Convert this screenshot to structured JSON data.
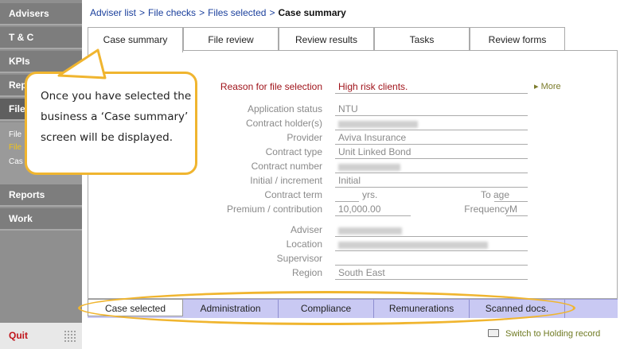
{
  "sidebar": {
    "items": [
      {
        "label": "Advisers"
      },
      {
        "label": "T & C"
      },
      {
        "label": "KPIs"
      },
      {
        "label": "Rep"
      },
      {
        "label": "File"
      },
      {
        "label": "Reports"
      },
      {
        "label": "Work"
      }
    ],
    "subitems": [
      {
        "label": "File"
      },
      {
        "label": "File"
      },
      {
        "label": "Cas"
      }
    ],
    "quit_label": "Quit"
  },
  "breadcrumb": {
    "items": [
      "Adviser list",
      "File checks",
      "Files selected"
    ],
    "separator": ">",
    "current": "Case summary"
  },
  "top_tabs": [
    "Case summary",
    "File review",
    "Review results",
    "Tasks",
    "Review forms"
  ],
  "form": {
    "reason_label": "Reason for file selection",
    "reason_value": "High risk clients.",
    "more_label": "More",
    "fields": {
      "application_status": {
        "label": "Application status",
        "value": "NTU"
      },
      "contract_holders": {
        "label": "Contract holder(s)",
        "value": ""
      },
      "provider": {
        "label": "Provider",
        "value": "Aviva Insurance"
      },
      "contract_type": {
        "label": "Contract type",
        "value": "Unit Linked Bond"
      },
      "contract_number": {
        "label": "Contract number",
        "value": ""
      },
      "initial_increment": {
        "label": "Initial / increment",
        "value": "Initial"
      },
      "contract_term": {
        "label": "Contract term",
        "value": "",
        "unit": "yrs."
      },
      "to_age": {
        "label": "To age",
        "value": ""
      },
      "premium": {
        "label": "Premium / contribution",
        "value": "10,000.00"
      },
      "frequency": {
        "label": "Frequency",
        "value": "M"
      },
      "adviser": {
        "label": "Adviser",
        "value": ""
      },
      "location": {
        "label": "Location",
        "value": ""
      },
      "supervisor": {
        "label": "Supervisor",
        "value": ""
      },
      "region": {
        "label": "Region",
        "value": "South East"
      }
    }
  },
  "bottom_tabs": [
    "Case selected",
    "Administration",
    "Compliance",
    "Remunerations",
    "Scanned docs."
  ],
  "holding_link": "Switch to Holding record",
  "callout": {
    "text": "Once you have selected the business a ‘Case summary’ screen will be displayed."
  },
  "colors": {
    "sidebar": "#7d7d7d",
    "highlight": "#f0b52f",
    "reason": "#a0141b",
    "bottom_bar": "#c9c9f3",
    "link": "#1a3f9c"
  }
}
